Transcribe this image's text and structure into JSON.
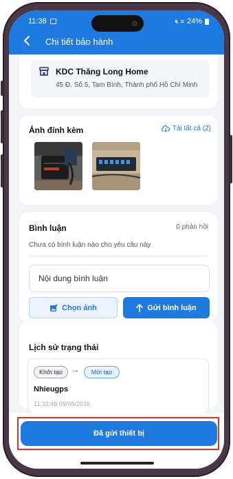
{
  "status": {
    "time": "11:38",
    "battery": "24%",
    "signal": "∟≈▊"
  },
  "header": {
    "title": "Chi tiết bảo hành",
    "back_icon": "‹"
  },
  "store": {
    "icon": "▦",
    "name": "KDC Thăng Long Home",
    "address": "45 Đ. Số 5, Tam Bình, Thành phố Hồ Chí Minh"
  },
  "attachments": {
    "title": "Ảnh đính kèm",
    "download_all": "Tải tất cả (2)",
    "download_icon": "⇩"
  },
  "comments": {
    "title": "Bình luận",
    "reply_count": "0 phản hồi",
    "empty_text": "Chưa có bình luận nào cho yêu cầu này",
    "input_placeholder": "Nội dung bình luận",
    "choose_image_label": "Chọn ảnh",
    "send_label": "Gửi bình luận"
  },
  "history": {
    "title": "Lịch sử trạng thái",
    "from_status": "Khởi tạo",
    "arrow": "→",
    "to_status": "Mới tạo",
    "user": "Nhieugps",
    "time": "11:33:46 09/06/2026"
  },
  "action": {
    "primary_label": "Đã gửi thiết bị"
  },
  "colors": {
    "brand": "#1f7ae0",
    "highlight": "#e03030",
    "frame": "#4a3848"
  }
}
